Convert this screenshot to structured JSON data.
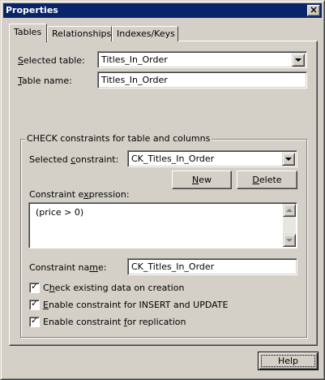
{
  "window": {
    "title": "Properties",
    "close_glyph": "×"
  },
  "tabs": [
    {
      "label": "Tables",
      "active": true
    },
    {
      "label": "Relationships",
      "active": false
    },
    {
      "label": "Indexes/Keys",
      "active": false
    }
  ],
  "selected_table": {
    "label_ul": "S",
    "label_rest": "elected table:",
    "value": "Titles_In_Order"
  },
  "table_name": {
    "label_ul": "T",
    "label_rest": "able name:",
    "value": "Titles_In_Order"
  },
  "check_group": {
    "title": "CHECK constraints for table and columns",
    "selected_constraint": {
      "label_pre": "Selected ",
      "label_ul": "c",
      "label_post": "onstraint:",
      "value": "CK_Titles_In_Order"
    },
    "new_button": {
      "ul": "N",
      "rest": "ew"
    },
    "delete_button": {
      "ul": "D",
      "rest": "elete"
    },
    "expression": {
      "label_pre": "Constraint e",
      "label_ul": "x",
      "label_post": "pression:",
      "value": "(price > 0)"
    },
    "constraint_name": {
      "label_pre": "Constraint na",
      "label_ul": "m",
      "label_post": "e:",
      "value": "CK_Titles_In_Order"
    },
    "checkboxes": [
      {
        "pre": "C",
        "ul": "h",
        "post": "eck existing data on creation",
        "checked": true
      },
      {
        "pre": "",
        "ul": "E",
        "post": "nable constraint for INSERT and UPDATE",
        "checked": true
      },
      {
        "pre": "Enable constraint ",
        "ul": "f",
        "post": "or replication",
        "checked": true
      }
    ]
  },
  "help_button": "Help",
  "colors": {
    "titlebar": "#0a246a",
    "face": "#d4d0c8"
  }
}
